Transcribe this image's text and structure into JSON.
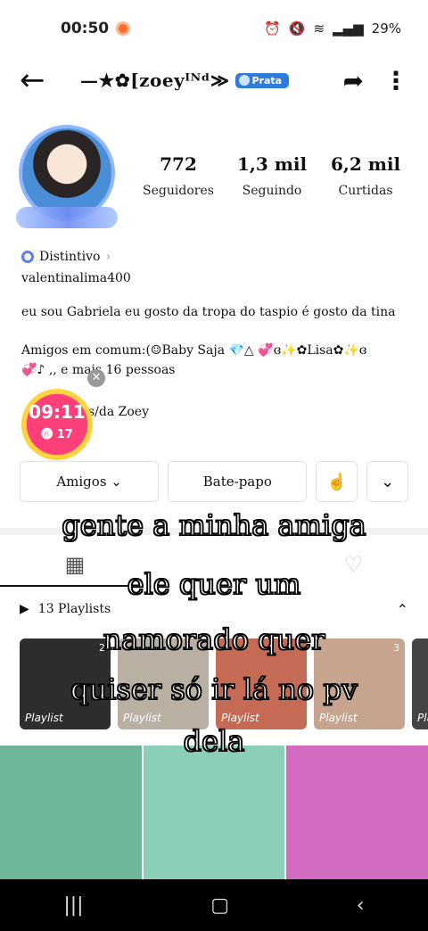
{
  "status": {
    "time": "00:50",
    "battery": "29%"
  },
  "header": {
    "title": "—★✿[zoeyᴵᴺᵈ≫",
    "badge": "Prata"
  },
  "stats": [
    {
      "value": "772",
      "label": "Seguidores"
    },
    {
      "value": "1,3 mil",
      "label": "Seguindo"
    },
    {
      "value": "6,2 mil",
      "label": "Curtidas"
    }
  ],
  "bio": {
    "distintivo": "Distintivo",
    "username": "valentinalima400",
    "description": "eu sou Gabriela eu gosto da tropa do taspio é gosto da tina",
    "friends_line1": "Amigos em comum:(☺Baby Saja 💎△͏  💞ɞ✨✿Lisa✿✨ɞ",
    "friends_line2": "💞♪ ,, e mais 16 pessoas",
    "link": "ps/da Zoey"
  },
  "timer": {
    "time": "09:11",
    "coins": "17"
  },
  "buttons": {
    "friends": "Amigos",
    "chat": "Bate-papo"
  },
  "playlists": {
    "title": "13 Playlists",
    "items": [
      {
        "label": "Playlist",
        "count": "2",
        "color": "#2d2d2d"
      },
      {
        "label": "Playlist",
        "count": "",
        "color": "#b9b0a3"
      },
      {
        "label": "Playlist",
        "count": "",
        "color": "#c46a55"
      },
      {
        "label": "Playlist",
        "count": "3",
        "color": "#c7a48e"
      },
      {
        "label": "Pla",
        "count": "",
        "color": "#444"
      }
    ]
  },
  "grid_colors": [
    "#6fb59a",
    "#8ccfb8",
    "#d06bbf"
  ],
  "overlay_text": [
    "gente a minha amiga",
    "ele quer um",
    "namorado quer",
    "quiser só ir lá no pv",
    "dela"
  ]
}
